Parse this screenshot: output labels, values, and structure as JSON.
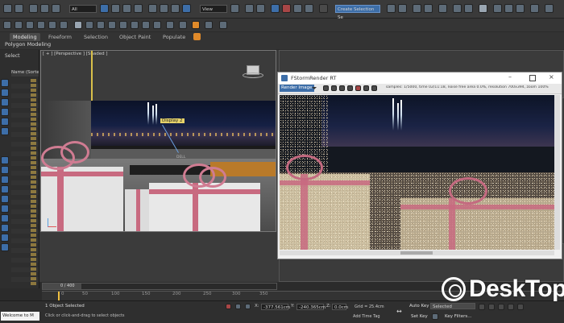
{
  "toolbar": {
    "selection_filter": "All",
    "view_dropdown": "View",
    "create_selection_set": "Create Selection Se"
  },
  "ribbon": {
    "tabs": [
      "Modeling",
      "Freeform",
      "Selection",
      "Object Paint",
      "Populate"
    ],
    "active_tab": "Modeling",
    "panel_label": "Polygon Modeling"
  },
  "scene_explorer": {
    "select_label": "Select",
    "column_header": "Name (Sorte"
  },
  "viewport": {
    "label": "[ + ] [Perspective ] [Shaded ]",
    "tooltip": "Display 2",
    "monitor_brand": "DELL"
  },
  "frame_buffer": {
    "title": "FStormRender RT",
    "channel": "Render Image",
    "stats": "samples: 1/5000, time 02/11:18, noise free area 0.0%, resolution 700x394, zoom 100%"
  },
  "timeline": {
    "frame_readout": "0 / 400",
    "ticks": [
      "0",
      "50",
      "100",
      "150",
      "200",
      "250",
      "300",
      "350"
    ]
  },
  "status_bar": {
    "maxscript": "Welcome to M",
    "objects_selected": "1 Object Selected",
    "prompt": "Click or click-and-drag to select objects",
    "x_value": "-377.561cm",
    "y_value": "-240.365cm",
    "z_value": "0.0cm",
    "grid": "Grid = 25.4cm",
    "add_time_tag": "Add Time Tag",
    "auto_key": "Auto Key",
    "set_key": "Set Key",
    "selected_dropdown": "Selected",
    "key_filters": "Key Filters..."
  },
  "watermark": {
    "text": "DeskTop",
    "colors": {
      "icon": "#ffffff",
      "text": "#ffffff"
    }
  },
  "colors": {
    "ui_bg": "#2b2b2b",
    "toolbar": "#3a3a3a",
    "frame_buffer_bg": "#f0f0f0",
    "active_blue": "#3d6ea8"
  }
}
